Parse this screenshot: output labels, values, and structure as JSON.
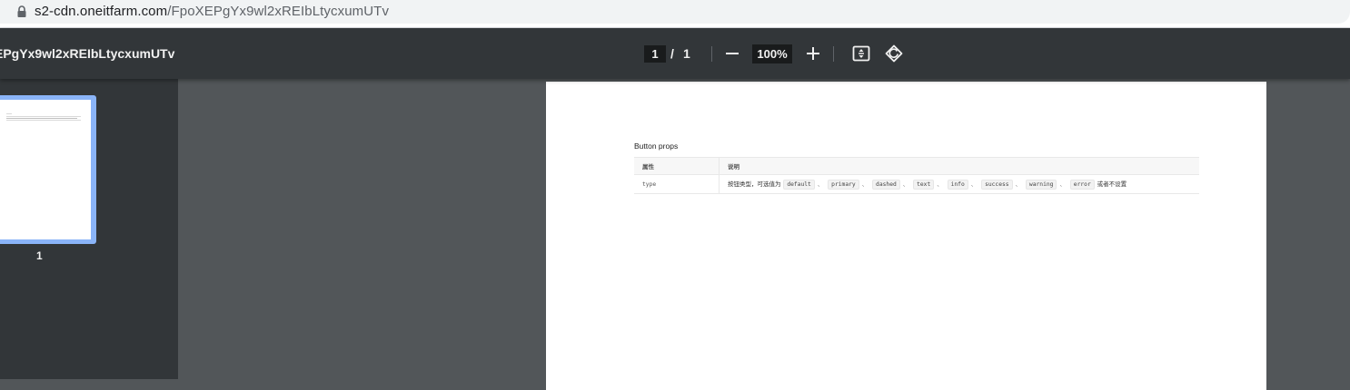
{
  "address_bar": {
    "url_host": "s2-cdn.oneitfarm.com",
    "url_path": "/FpoXEPgYx9wl2xREIbLtycxumUTv"
  },
  "toolbar": {
    "doc_title": "EPgYx9wl2xREIbLtycxumUTv",
    "current_page": "1",
    "page_separator": "/",
    "total_pages": "1",
    "zoom": "100%"
  },
  "sidebar": {
    "thumbnails": [
      {
        "page_label": "1"
      }
    ]
  },
  "document": {
    "heading": "Button props",
    "table": {
      "headers": [
        "属性",
        "说明"
      ],
      "rows": [
        {
          "property": "type",
          "description_prefix": "按钮类型，可选值为",
          "values": [
            "default",
            "primary",
            "dashed",
            "text",
            "info",
            "success",
            "warning",
            "error"
          ],
          "value_separator": "、",
          "description_suffix": "或者不设置"
        }
      ]
    }
  }
}
